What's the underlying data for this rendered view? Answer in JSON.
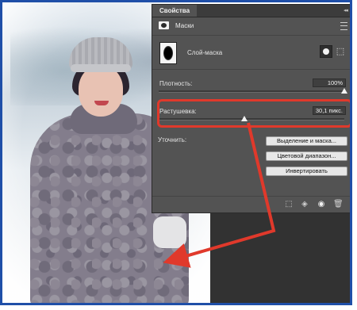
{
  "panel": {
    "tab_title": "Свойства",
    "collapse_glyph": "◂◂",
    "section_title": "Маски",
    "layer_mask_label": "Слой-маска",
    "vector_mask_glyph": "⬚"
  },
  "properties": {
    "density": {
      "label": "Плотность:",
      "value": "100%",
      "level_percent": 100
    },
    "feather": {
      "label": "Растушевка:",
      "value": "30,1 пикс.",
      "level_fraction": 0.46
    }
  },
  "refine": {
    "label": "Уточнить:",
    "buttons": [
      "Выделение и маска...",
      "Цветовой диапазон...",
      "Инвертировать"
    ]
  },
  "bottom_icons": [
    "load-selection-icon",
    "apply-mask-icon",
    "visibility-eye-icon",
    "trash-icon"
  ],
  "colors": {
    "panel_bg": "#535353",
    "highlight": "#e0392b",
    "arrow": "#e0392b",
    "frame": "#1f4fa8"
  }
}
